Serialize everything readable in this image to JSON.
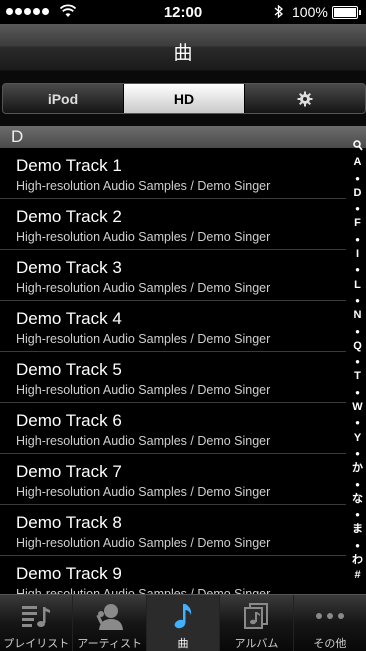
{
  "status": {
    "time": "12:00",
    "battery": "100%"
  },
  "nav": {
    "title": "曲"
  },
  "segments": [
    {
      "label": "iPod",
      "active": false
    },
    {
      "label": "HD",
      "active": true
    },
    {
      "icon": "gear-icon",
      "active": false
    }
  ],
  "section": {
    "letter": "D"
  },
  "tracks": [
    {
      "title": "Demo Track 1",
      "subtitle": "High-resolution Audio Samples / Demo Singer"
    },
    {
      "title": "Demo Track 2",
      "subtitle": "High-resolution Audio Samples / Demo Singer"
    },
    {
      "title": "Demo Track 3",
      "subtitle": "High-resolution Audio Samples / Demo Singer"
    },
    {
      "title": "Demo Track 4",
      "subtitle": "High-resolution Audio Samples / Demo Singer"
    },
    {
      "title": "Demo Track 5",
      "subtitle": "High-resolution Audio Samples / Demo Singer"
    },
    {
      "title": "Demo Track 6",
      "subtitle": "High-resolution Audio Samples / Demo Singer"
    },
    {
      "title": "Demo Track 7",
      "subtitle": "High-resolution Audio Samples / Demo Singer"
    },
    {
      "title": "Demo Track 8",
      "subtitle": "High-resolution Audio Samples / Demo Singer"
    },
    {
      "title": "Demo Track 9",
      "subtitle": "High-resolution Audio Samples / Demo Singer"
    }
  ],
  "index": [
    "🔍",
    "A",
    "●",
    "D",
    "●",
    "F",
    "●",
    "I",
    "●",
    "L",
    "●",
    "N",
    "●",
    "Q",
    "●",
    "T",
    "●",
    "W",
    "●",
    "Y",
    "●",
    "か",
    "●",
    "な",
    "●",
    "ま",
    "●",
    "わ",
    "#"
  ],
  "tabs": [
    {
      "label": "プレイリスト",
      "icon": "playlist-icon",
      "active": false
    },
    {
      "label": "アーティスト",
      "icon": "artist-icon",
      "active": false
    },
    {
      "label": "曲",
      "icon": "music-note-icon",
      "active": true
    },
    {
      "label": "アルバム",
      "icon": "album-icon",
      "active": false
    },
    {
      "label": "その他",
      "icon": "more-icon",
      "active": false
    }
  ],
  "colors": {
    "accent": "#3fb1ff",
    "background": "#000000"
  }
}
